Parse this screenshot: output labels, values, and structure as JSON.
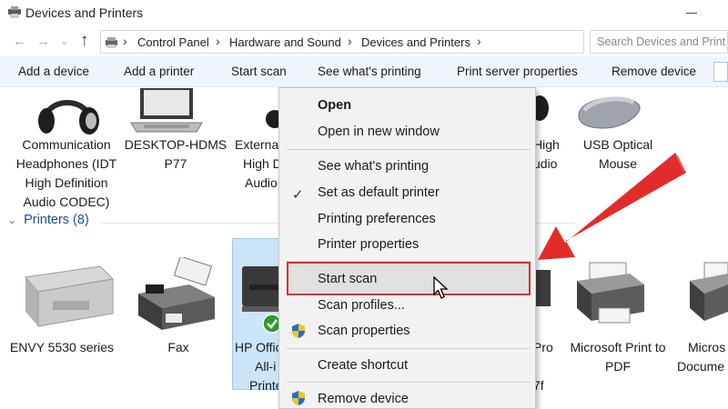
{
  "window": {
    "title": "Devices and Printers"
  },
  "address": {
    "breadcrumbs": [
      "Control Panel",
      "Hardware and Sound",
      "Devices and Printers"
    ],
    "search_placeholder": "Search Devices and Print"
  },
  "toolbar": {
    "add_device": "Add a device",
    "add_printer": "Add a printer",
    "start_scan": "Start scan",
    "see_printing": "See what's printing",
    "print_server": "Print server properties",
    "remove_device": "Remove device"
  },
  "devices": {
    "communication_headphones": [
      "Communication",
      "Headphones (IDT",
      "High Definition",
      "Audio CODEC)"
    ],
    "desktop": [
      "DESKTOP-HDMS",
      "P77"
    ],
    "external_high_def": [
      "Externa",
      "High D",
      "Audio"
    ],
    "high_audio": [
      "High",
      "udio"
    ],
    "usb_mouse": [
      "USB Optical",
      "Mouse"
    ]
  },
  "printers_group": {
    "label": "Printers (8)"
  },
  "printers": {
    "envy": [
      "ENVY 5530 series"
    ],
    "fax": [
      "Fax"
    ],
    "hp_officejet": [
      "HP Offic",
      "All-i",
      "Printe"
    ],
    "pro": [
      "Pro",
      "7f"
    ],
    "ms_print_pdf": [
      "Microsoft Print to",
      "PDF"
    ],
    "ms_document": [
      "Micros",
      "Docume"
    ]
  },
  "context_menu": {
    "open": "Open",
    "open_new_window": "Open in new window",
    "see_printing": "See what's printing",
    "set_default": "Set as default printer",
    "printing_prefs": "Printing preferences",
    "printer_props": "Printer properties",
    "start_scan": "Start scan",
    "scan_profiles": "Scan profiles...",
    "scan_props": "Scan properties",
    "create_shortcut": "Create shortcut",
    "remove_device": "Remove device"
  },
  "colors": {
    "accent_red": "#e22c2c",
    "command_bar_bg": "#f0f5fb",
    "group_header_blue": "#1e4e8c",
    "selection_blue": "#cce4f7"
  }
}
